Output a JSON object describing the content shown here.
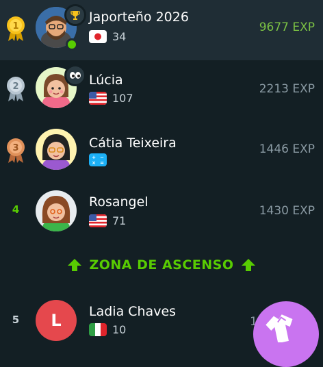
{
  "rows": [
    {
      "rank": "1",
      "name": "Japorteño 2026",
      "score": "34",
      "xp": "9677 EXP"
    },
    {
      "rank": "2",
      "name": "Lúcia",
      "score": "107",
      "xp": "2213 EXP"
    },
    {
      "rank": "3",
      "name": "Cátia Teixeira",
      "score": "",
      "xp": "1446 EXP"
    },
    {
      "rank": "4",
      "name": "Rosangel",
      "score": "71",
      "xp": "1430 EXP"
    },
    {
      "rank": "5",
      "name": "Ladia Chaves",
      "score": "10",
      "xp": "1"
    }
  ],
  "promotion_label": "ZONA DE ASCENSO",
  "avatar_initial": "L",
  "colors": {
    "background": "#131f24",
    "highlight": "#1f2d35",
    "green": "#58cc02",
    "gold": "#f7c21b",
    "silver": "#b8c6d1",
    "bronze": "#e0915a",
    "fab": "#c974f0"
  },
  "icons": [
    "trophy-icon",
    "eyes-icon",
    "medal-gold-icon",
    "medal-silver-icon",
    "medal-bronze-icon",
    "arrow-up-icon",
    "jersey-icon"
  ]
}
